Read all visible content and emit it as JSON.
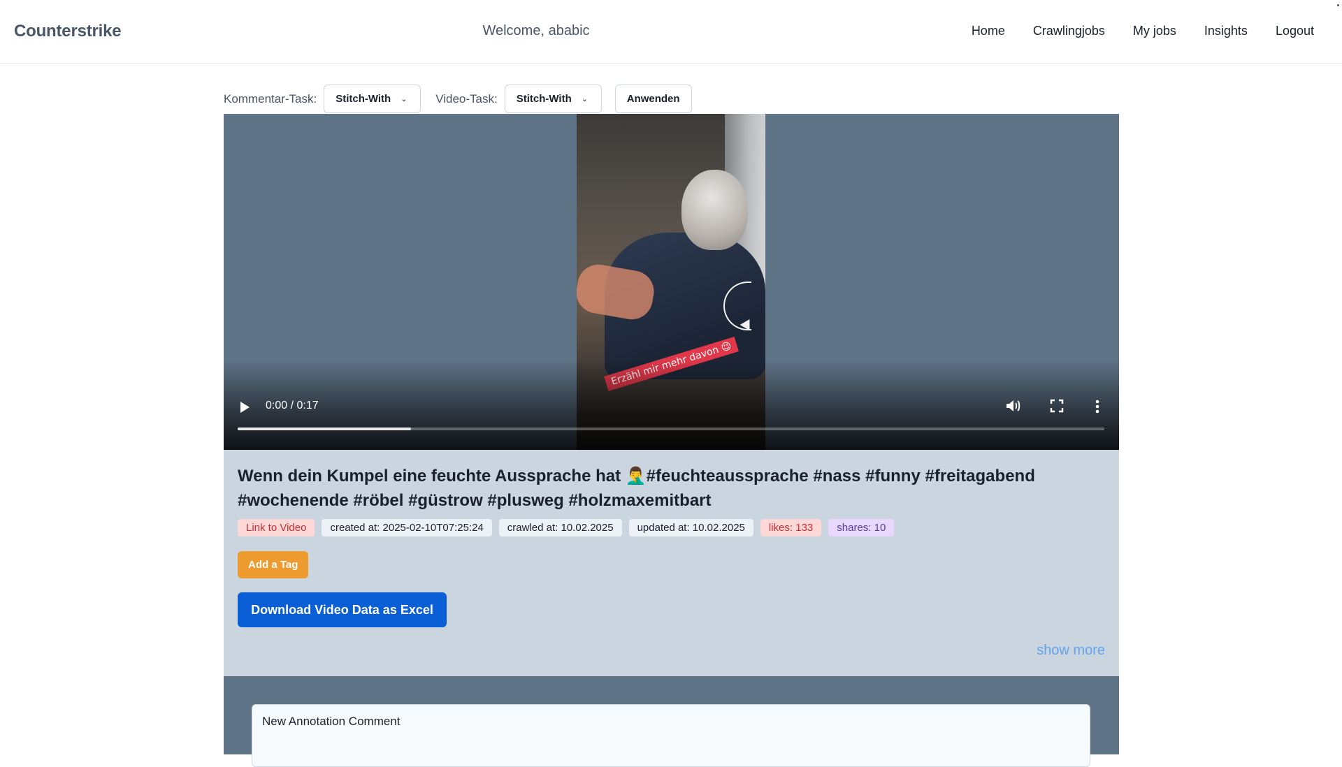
{
  "header": {
    "brand": "Counterstrike",
    "welcome": "Welcome, ababic",
    "nav": [
      "Home",
      "Crawlingjobs",
      "My jobs",
      "Insights",
      "Logout"
    ]
  },
  "tasks": {
    "comment_label": "Kommentar-Task:",
    "comment_value": "Stitch-With",
    "video_label": "Video-Task:",
    "video_value": "Stitch-With",
    "apply_label": "Anwenden"
  },
  "video": {
    "time": "0:00 / 0:17",
    "sticker_text": "Erzähl mir mehr davon 😉",
    "progress_fraction": 0.2,
    "icons": [
      "play-icon",
      "volume-icon",
      "fullscreen-icon",
      "more-vert-icon"
    ]
  },
  "info": {
    "title": "Wenn dein Kumpel eine feuchte Aussprache hat 🤦‍♂️#feuchteaussprache #nass #funny #freitagabend #wochenende #röbel #güstrow #plusweg #holzmaxemitbart",
    "badges": {
      "link": "Link to Video",
      "created": "created at: 2025-02-10T07:25:24",
      "crawled": "crawled at: 10.02.2025",
      "updated": "updated at: 10.02.2025",
      "likes": "likes: 133",
      "shares": "shares: 10"
    },
    "add_tag": "Add a Tag",
    "download": "Download Video Data as Excel",
    "show_more": "show more"
  },
  "annotation": {
    "placeholder": "New Annotation Comment"
  },
  "colors": {
    "video_bg": "#607488",
    "panel_bg": "#cbd5e0",
    "tag_button": "#ed9a2e",
    "download_button": "#0b5fd6",
    "show_more": "#63a4e8"
  }
}
